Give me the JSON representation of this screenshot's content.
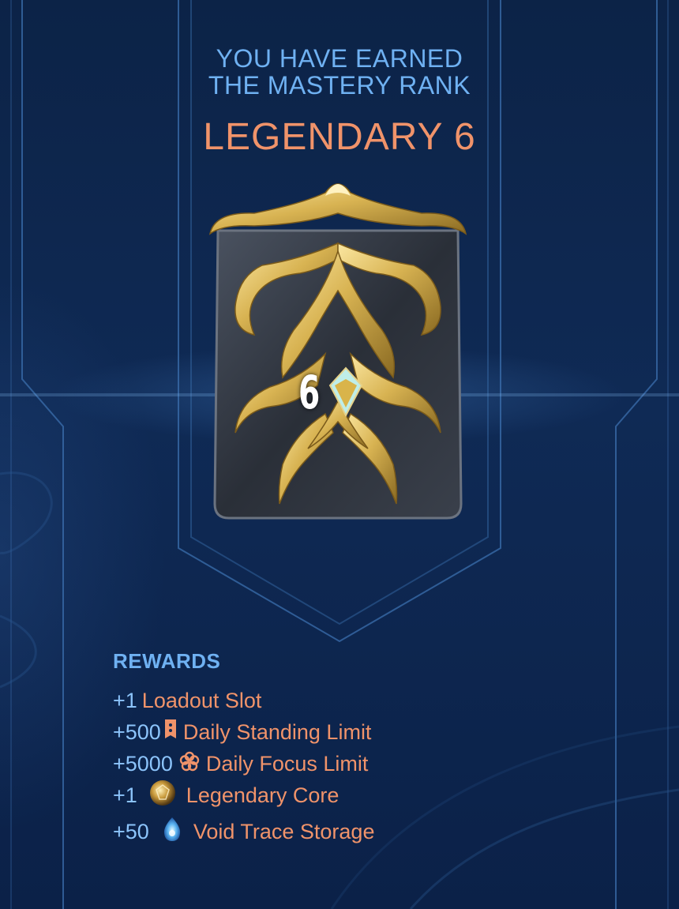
{
  "header": {
    "line1": "YOU HAVE EARNED",
    "line2": "THE MASTERY RANK",
    "rank_name": "LEGENDARY 6"
  },
  "emblem": {
    "rank_number": "6",
    "icon": "mastery-legendary-emblem-icon"
  },
  "rewards": {
    "title": "REWARDS",
    "items": [
      {
        "amount": "+1",
        "icon": "",
        "label": "Loadout Slot"
      },
      {
        "amount": "+500",
        "icon": "standing-icon",
        "label": "Daily Standing Limit"
      },
      {
        "amount": "+5000",
        "icon": "focus-icon",
        "label": "Daily Focus Limit"
      },
      {
        "amount": "+1",
        "icon": "legendary-core-icon",
        "label": "Legendary Core"
      },
      {
        "amount": "+50",
        "icon": "void-trace-icon",
        "label": "Void Trace Storage"
      }
    ]
  },
  "colors": {
    "background": "#0f2a55",
    "heading": "#6fb1f2",
    "rank_name": "#f0936a",
    "reward_amount": "#8cc4fb",
    "reward_label": "#f0936a",
    "gold": "#d8b352"
  }
}
